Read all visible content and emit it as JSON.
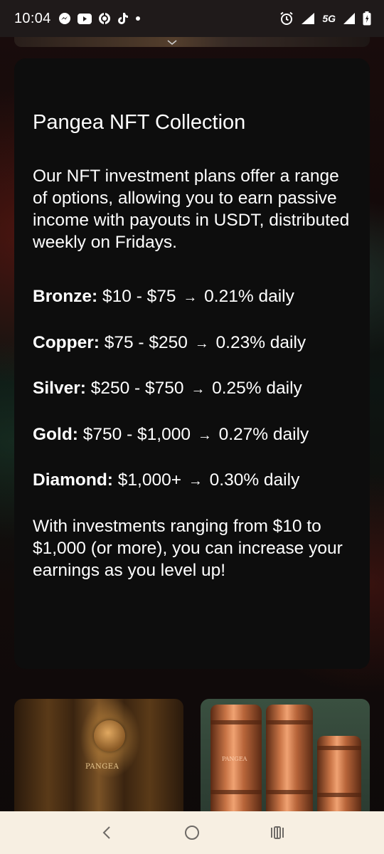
{
  "status_bar": {
    "time": "10:04",
    "network": "5G",
    "left_icons": [
      "messenger-icon",
      "youtube-icon",
      "app-icon",
      "tiktok-icon",
      "dot-icon"
    ],
    "right_icons": [
      "alarm-icon",
      "signal-icon",
      "signal-icon",
      "battery-icon"
    ]
  },
  "card": {
    "title": "Pangea NFT Collection",
    "intro": "Our NFT investment plans offer a range of options, allowing you to earn passive income with payouts in USDT, distributed weekly on Fridays.",
    "arrow": "→",
    "plans": [
      {
        "name": "Bronze:",
        "range": "$10 - $75",
        "rate": "0.21% daily"
      },
      {
        "name": "Copper:",
        "range": "$75 - $250",
        "rate": "0.23% daily"
      },
      {
        "name": "Silver:",
        "range": "$250 - $750",
        "rate": "0.25% daily"
      },
      {
        "name": "Gold:",
        "range": "$750 - $1,000",
        "rate": "0.27% daily"
      },
      {
        "name": "Diamond:",
        "range": "$1,000+",
        "rate": "0.30% daily"
      }
    ],
    "outro": "With investments ranging from $10 to $1,000 (or more), you can increase your earnings as you level up!"
  },
  "thumbnails": [
    {
      "name": "bronze-nft-image",
      "label": "PANGEA"
    },
    {
      "name": "copper-nft-image",
      "label": "PANGEA"
    }
  ],
  "nav_bar": {
    "icons": [
      "back-icon",
      "home-icon",
      "recents-icon"
    ]
  }
}
